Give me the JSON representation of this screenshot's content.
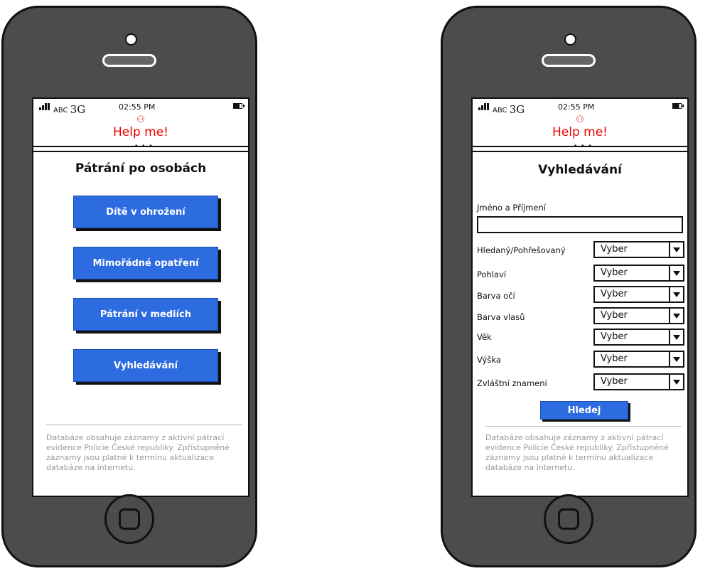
{
  "status": {
    "carrier": "ABC",
    "network": "3G",
    "time": "02:55 PM"
  },
  "header": {
    "logo_glyph": "⚇",
    "title": "Help me!",
    "dots": "• • •"
  },
  "screen_left": {
    "heading": "Pátrání po osobách",
    "buttons": [
      "Dítě v ohrožení",
      "Mimořádné opatření",
      "Pátrání v mediích",
      "Vyhledávání"
    ],
    "footer": "Databáze obsahuje záznamy z aktivní pátrací evidence Policie České republiky. Zpřístupněné záznamy jsou platné k termínu aktualizace databáze na internetu."
  },
  "screen_right": {
    "heading": "Vyhledávání",
    "name_label": "Jméno a Příjmení",
    "name_value": "",
    "fields": [
      {
        "label": "Hledaný/Pohřešovaný",
        "value": "Vyber"
      },
      {
        "label": "Pohlaví",
        "value": "Vyber"
      },
      {
        "label": "Barva očí",
        "value": "Vyber"
      },
      {
        "label": "Barva vlasů",
        "value": "Vyber"
      },
      {
        "label": "Věk",
        "value": "Vyber"
      },
      {
        "label": "Výška",
        "value": "Vyber"
      },
      {
        "label": "Zvláštní znamení",
        "value": "Vyber"
      }
    ],
    "search_button": "Hledej",
    "footer": "Databáze obsahuje záznamy z aktivní pátrací evidence Policie České republiky. Zpřístupněné záznamy jsou platné k termínu aktualizace databáze na internetu."
  },
  "colors": {
    "button": "#2d6be0",
    "title_red": "#e00",
    "phone_body": "#4c4c4c"
  }
}
